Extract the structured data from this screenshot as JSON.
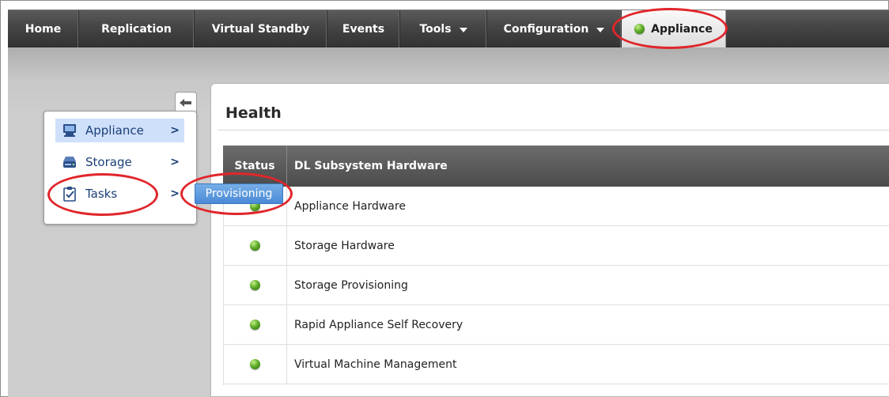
{
  "nav": {
    "tabs": [
      {
        "label": "Home"
      },
      {
        "label": "Replication"
      },
      {
        "label": "Virtual Standby"
      },
      {
        "label": "Events"
      },
      {
        "label": "Tools"
      },
      {
        "label": "Configuration"
      },
      {
        "label": "Appliance"
      }
    ],
    "active_tab": "Appliance"
  },
  "sidebar": {
    "items": [
      {
        "label": "Appliance",
        "icon": "monitor-icon",
        "arrow": ">"
      },
      {
        "label": "Storage",
        "icon": "drive-icon",
        "arrow": ">"
      },
      {
        "label": "Tasks",
        "icon": "clipboard-icon",
        "arrow": ">"
      }
    ],
    "submenu": {
      "label": "Provisioning"
    }
  },
  "health": {
    "title": "Health",
    "columns": [
      "Status",
      "DL Subsystem Hardware"
    ],
    "rows": [
      {
        "name": "Appliance Hardware",
        "status": "ok"
      },
      {
        "name": "Storage Hardware",
        "status": "ok"
      },
      {
        "name": "Storage Provisioning",
        "status": "ok"
      },
      {
        "name": "Rapid Appliance Self Recovery",
        "status": "ok"
      },
      {
        "name": "Virtual Machine Management",
        "status": "ok"
      }
    ]
  },
  "colors": {
    "status_ok": "#5fae2a",
    "annotation": "#e0262b",
    "menu_selected": "#cfe0fb",
    "submenu_bg": "#4a8ad6"
  }
}
